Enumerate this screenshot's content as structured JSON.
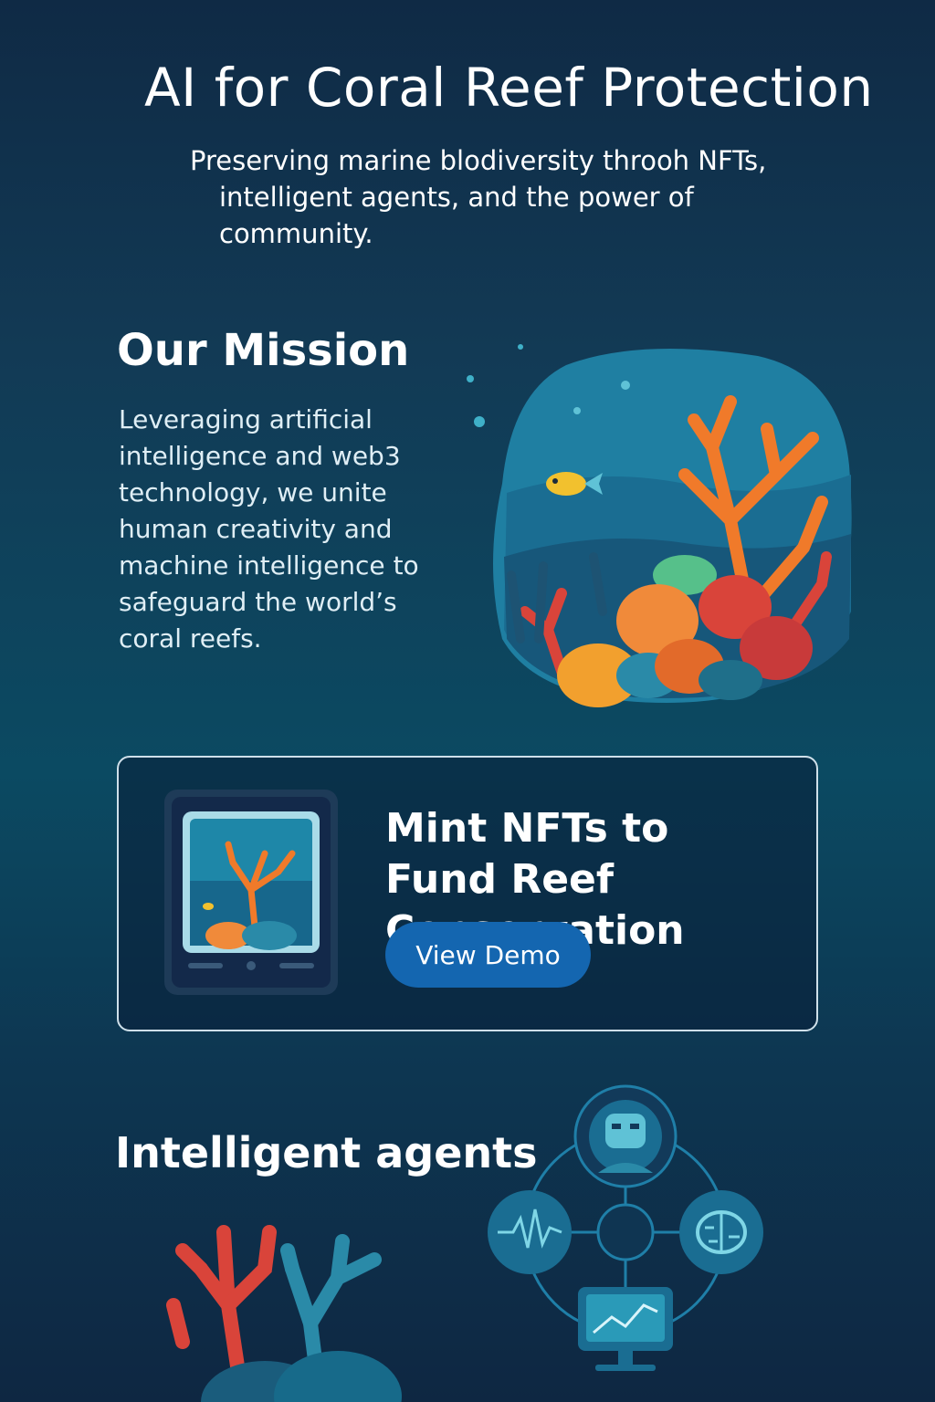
{
  "hero": {
    "title": "AI for Coral Reef Protection",
    "subtitle_line1": "Preserving marine blodiversity throoh NFTs,",
    "subtitle_line2": "intelligent agents, and the power of",
    "subtitle_line3": "community."
  },
  "mission": {
    "heading": "Our Mission",
    "text": "Leveraging artificial intelligence and web3 technology, we unite human creativity and machine intelligence to safeguard the world’s coral reefs.",
    "illustration": "coral-reef-illustration"
  },
  "nft_card": {
    "title": "Mint NFTs to Fund Reef Conservation",
    "button_label": "View Demo",
    "device_icon": "tablet-coral-nft-icon"
  },
  "agents": {
    "heading": "Intelligent agents",
    "icons": [
      "robot-avatar-icon",
      "waveform-icon",
      "brain-icon",
      "monitor-chart-icon"
    ]
  },
  "colors": {
    "accent_button": "#1466b0",
    "coral_orange": "#f07a2a",
    "coral_red": "#d9443a",
    "teal": "#2a8aa8"
  }
}
